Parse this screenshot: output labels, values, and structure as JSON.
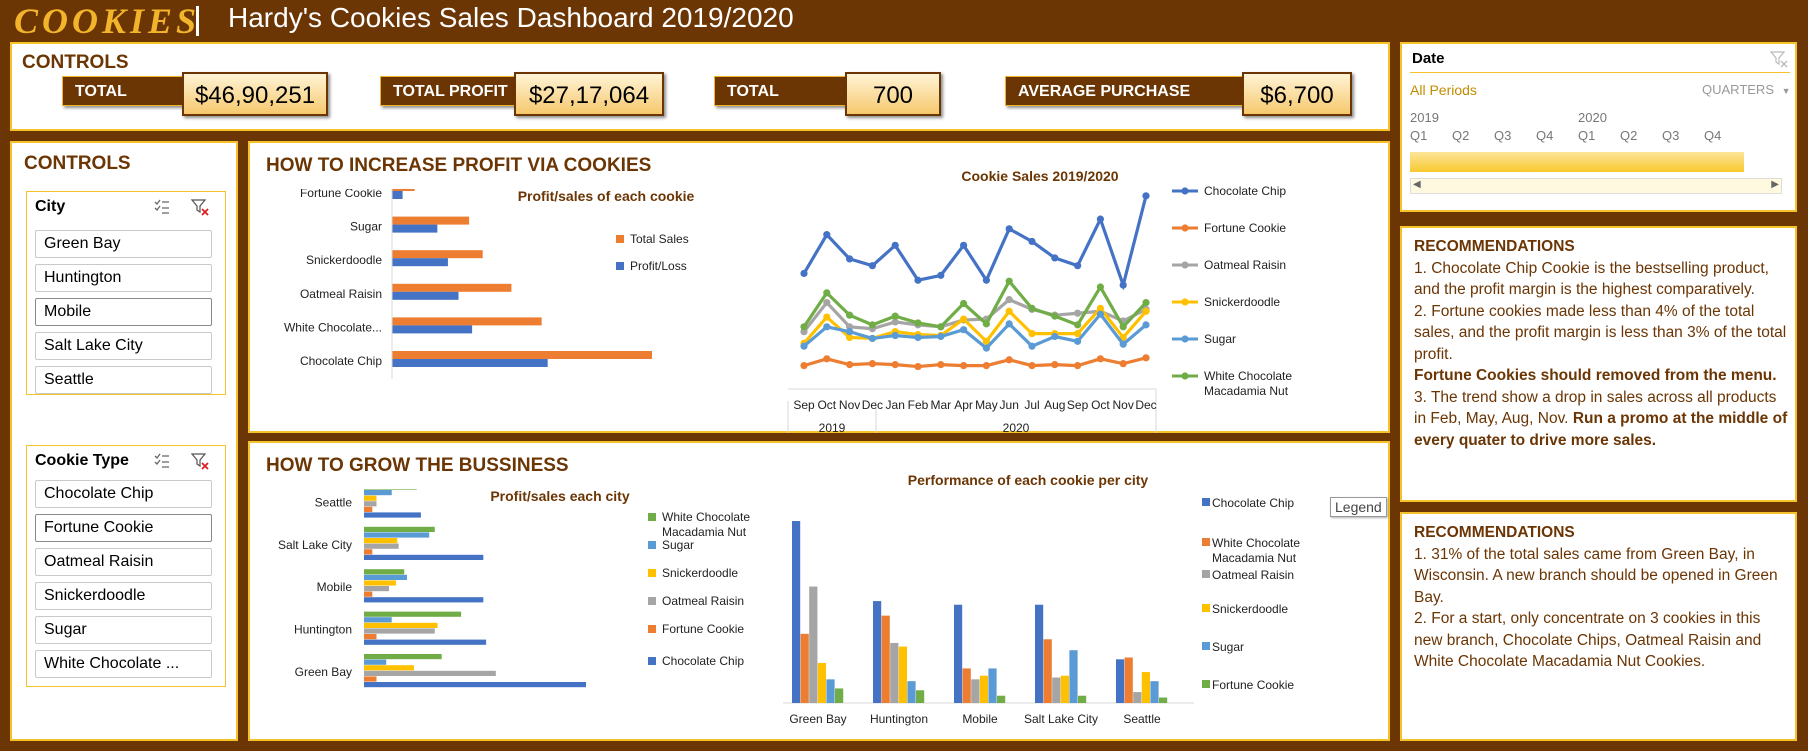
{
  "header": {
    "logo": "COOKIES",
    "title": "Hardy's Cookies Sales Dashboard 2019/2020"
  },
  "kpi": {
    "heading": "CONTROLS",
    "items": [
      {
        "label": "TOTAL SALES",
        "value": "$46,90,251"
      },
      {
        "label": "TOTAL PROFIT",
        "value": "$27,17,064"
      },
      {
        "label": "TOTAL ORDERS",
        "value": "700"
      },
      {
        "label": "AVERAGE PURCHASE ORDER",
        "value": "$6,700"
      }
    ]
  },
  "controls": {
    "heading": "CONTROLS",
    "city_slicer": {
      "title": "City",
      "items": [
        "Green Bay",
        "Huntington",
        "Mobile",
        "Salt Lake City",
        "Seattle"
      ]
    },
    "cookie_slicer": {
      "title": "Cookie Type",
      "items": [
        "Chocolate Chip",
        "Fortune Cookie",
        "Oatmeal Raisin",
        "Snickerdoodle",
        "Sugar",
        "White Chocolate ..."
      ]
    }
  },
  "date_slicer": {
    "title": "Date",
    "period": "All Periods",
    "level": "QUARTERS",
    "years": [
      "2019",
      "2020"
    ],
    "quarters": [
      "Q1",
      "Q2",
      "Q3",
      "Q4",
      "Q1",
      "Q2",
      "Q3",
      "Q4"
    ]
  },
  "section_profit": {
    "heading": "HOW TO INCREASE PROFIT VIA COOKIES"
  },
  "section_grow": {
    "heading": "HOW TO GROW THE BUSSINESS"
  },
  "tooltip": {
    "legend": "Legend"
  },
  "recommendations": [
    {
      "title": "RECOMMENDATIONS",
      "lines": [
        {
          "text": "1. Chocolate Chip Cookie is the bestselling product, and the profit margin is the highest comparatively.",
          "bold": false
        },
        {
          "text": "2. Fortune cookies made less than 4% of the total sales, and the profit margin is less than 3% of the total profit.",
          "bold": false
        },
        {
          "text": "Fortune Cookies should removed from the menu.",
          "bold": true
        },
        {
          "text": "3. The trend show a drop in sales across all products in Feb, May, Aug, Nov. ",
          "bold": false,
          "bold_tail": "Run a promo at the middle of every quater to drive more sales."
        }
      ]
    },
    {
      "title": "RECOMMENDATIONS",
      "lines": [
        {
          "text": "1. 31% of the total sales came from Green Bay, in Wisconsin. A new branch should be opened in Green Bay.",
          "bold": false
        },
        {
          "text": "2. For a start, only concentrate on 3 cookies in this new branch, Chocolate Chips, Oatmeal Raisin and White Chocolate Macadamia Nut Cookies.",
          "bold": false
        }
      ]
    }
  ],
  "colors": {
    "brown": "#6b3504",
    "gold": "#f5c22a",
    "blue": "#4472c4",
    "orange": "#ed7d31",
    "gray": "#a5a5a5",
    "yellow": "#ffc000",
    "lightblue": "#5b9bd5",
    "green": "#70ad47"
  },
  "chart_data": [
    {
      "type": "bar",
      "title": "Profit/sales of each cookie",
      "orientation": "horizontal",
      "categories": [
        "Chocolate Chip",
        "White Chocolate...",
        "Oatmeal Raisin",
        "Snickerdoodle",
        "Sugar",
        "Fortune Cookie"
      ],
      "series": [
        {
          "name": "Total Sales",
          "color": "#ed7d31",
          "values": [
            1720000,
            990000,
            790000,
            600000,
            510000,
            150000
          ]
        },
        {
          "name": "Profit/Loss",
          "color": "#4472c4",
          "values": [
            1030000,
            530000,
            440000,
            370000,
            300000,
            70000
          ]
        }
      ],
      "legend": "right"
    },
    {
      "type": "line",
      "title": "Cookie Sales 2019/2020",
      "x": [
        "Sep",
        "Oct",
        "Nov",
        "Dec",
        "Jan",
        "Feb",
        "Mar",
        "Apr",
        "May",
        "Jun",
        "Jul",
        "Aug",
        "Sep",
        "Oct",
        "Nov",
        "Dec"
      ],
      "x_groups": [
        {
          "label": "2019",
          "span": 4
        },
        {
          "label": "2020",
          "span": 12
        }
      ],
      "series": [
        {
          "name": "Chocolate Chip",
          "color": "#4472c4",
          "values": [
            115,
            155,
            130,
            123,
            144,
            108,
            113,
            144,
            108,
            161,
            148,
            131,
            123,
            171,
            103,
            195
          ]
        },
        {
          "name": "Fortune Cookie",
          "color": "#ed7d31",
          "values": [
            20,
            27,
            21,
            22,
            21,
            19,
            21,
            20,
            20,
            26,
            20,
            21,
            20,
            27,
            22,
            28
          ]
        },
        {
          "name": "Oatmeal Raisin",
          "color": "#a5a5a5",
          "values": [
            55,
            85,
            60,
            58,
            65,
            62,
            60,
            67,
            68,
            88,
            78,
            72,
            74,
            76,
            66,
            78
          ]
        },
        {
          "name": "Snickerdoodle",
          "color": "#ffc000",
          "values": [
            43,
            70,
            49,
            48,
            55,
            52,
            51,
            68,
            45,
            76,
            53,
            53,
            53,
            79,
            49,
            76
          ]
        },
        {
          "name": "Sugar",
          "color": "#5b9bd5",
          "values": [
            40,
            60,
            55,
            48,
            51,
            49,
            50,
            57,
            38,
            63,
            40,
            50,
            45,
            73,
            42,
            62
          ]
        },
        {
          "name": "White Chocolate Macadamia Nut",
          "color": "#70ad47",
          "values": [
            60,
            95,
            72,
            62,
            71,
            64,
            60,
            84,
            63,
            107,
            79,
            71,
            62,
            101,
            60,
            85
          ]
        }
      ],
      "legend": "right"
    },
    {
      "type": "bar",
      "title": "Profit/sales each city",
      "orientation": "horizontal",
      "categories": [
        "Green Bay",
        "Huntington",
        "Mobile",
        "Salt Lake City",
        "Seattle"
      ],
      "series": [
        {
          "name": "Chocolate Chip",
          "color": "#4472c4",
          "values": [
            160,
            88,
            86,
            86,
            41
          ]
        },
        {
          "name": "Fortune Cookie",
          "color": "#ed7d31",
          "values": [
            9,
            9,
            6,
            6,
            6
          ]
        },
        {
          "name": "Oatmeal Raisin",
          "color": "#a5a5a5",
          "values": [
            95,
            51,
            18,
            25,
            9
          ]
        },
        {
          "name": "Snickerdoodle",
          "color": "#ffc000",
          "values": [
            36,
            53,
            23,
            24,
            9
          ]
        },
        {
          "name": "Sugar",
          "color": "#5b9bd5",
          "values": [
            16,
            20,
            31,
            47,
            20
          ]
        },
        {
          "name": "White Chocolate Macadamia Nut",
          "color": "#70ad47",
          "values": [
            56,
            70,
            29,
            51,
            38
          ]
        }
      ],
      "legend": "right"
    },
    {
      "type": "bar",
      "title": "Performance of each cookie per city",
      "categories": [
        "Green Bay",
        "Huntington",
        "Mobile",
        "Salt Lake City",
        "Seattle"
      ],
      "series": [
        {
          "name": "Chocolate Chip",
          "color": "#4472c4",
          "values": [
            100,
            56,
            54,
            54,
            24
          ]
        },
        {
          "name": "White Chocolate Macadamia Nut",
          "color": "#ed7d31",
          "values": [
            38,
            48,
            19,
            35,
            25
          ]
        },
        {
          "name": "Oatmeal Raisin",
          "color": "#a5a5a5",
          "values": [
            64,
            33,
            13,
            14,
            6
          ]
        },
        {
          "name": "Snickerdoodle",
          "color": "#ffc000",
          "values": [
            22,
            31,
            15,
            15,
            17
          ]
        },
        {
          "name": "Sugar",
          "color": "#5b9bd5",
          "values": [
            13,
            12,
            19,
            29,
            12
          ]
        },
        {
          "name": "Fortune Cookie",
          "color": "#70ad47",
          "values": [
            8,
            7,
            4,
            4,
            3
          ]
        }
      ],
      "legend": "right"
    }
  ]
}
